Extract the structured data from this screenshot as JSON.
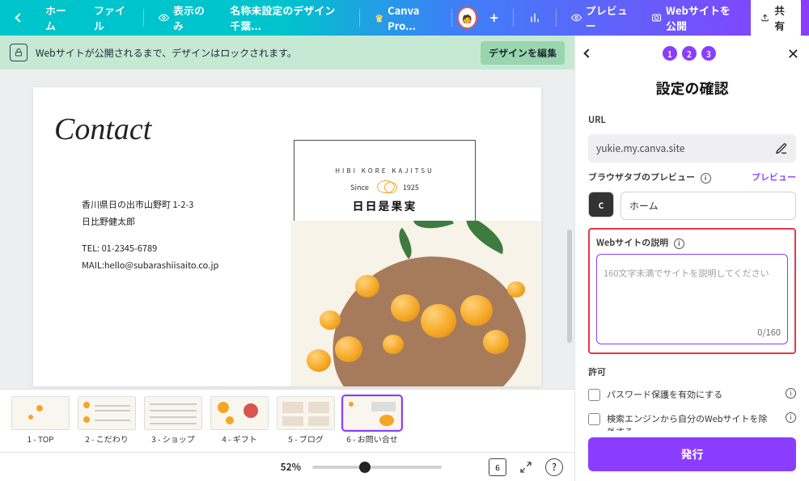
{
  "header": {
    "home": "ホーム",
    "file": "ファイル",
    "view_only": "表示のみ",
    "design_name": "名称未設定のデザイン 千葉...",
    "pro": "Canva Pro...",
    "preview": "プレビュー",
    "publish_site": "Webサイトを公開",
    "share": "共有"
  },
  "lockbar": {
    "message": "Webサイトが公開されるまで、デザインはロックされます。",
    "edit": "デザインを編集"
  },
  "canvas": {
    "contact_title": "Contact",
    "addr1": "香川県日の出市山野町  1-2-3",
    "addr2": "日比野健太郎",
    "tel_label": "TEL: 01-2345-6789",
    "mail_label": "MAIL:hello@subarashiisaito.co.jp",
    "brand_arc": "HIBI KORE KAJITSU",
    "brand_since": "Since",
    "brand_year": "1925",
    "brand_name": "日日是果実"
  },
  "thumbs": [
    {
      "label": "1 - TOP"
    },
    {
      "label": "2 - こだわり"
    },
    {
      "label": "3 - ショップ"
    },
    {
      "label": "4 - ギフト"
    },
    {
      "label": "5 - ブログ"
    },
    {
      "label": "6 - お問い合せ"
    }
  ],
  "zoom": {
    "pct": "52%",
    "page_count": "6"
  },
  "panel": {
    "steps": [
      "1",
      "2",
      "3"
    ],
    "title": "設定の確認",
    "url_label": "URL",
    "url_value": "yukie.my.canva.site",
    "tab_preview_label": "ブラウザタブのプレビュー",
    "preview_link": "プレビュー",
    "favico_letter": "C",
    "tab_title_value": "ホーム",
    "desc_label": "Webサイトの説明",
    "desc_placeholder": "160文字未満でサイトを説明してください",
    "desc_count": "0/160",
    "perm_label": "許可",
    "cb1": "パスワード保護を有効にする",
    "cb2": "検索エンジンから自分のWebサイトを除外する",
    "publish": "発行"
  }
}
